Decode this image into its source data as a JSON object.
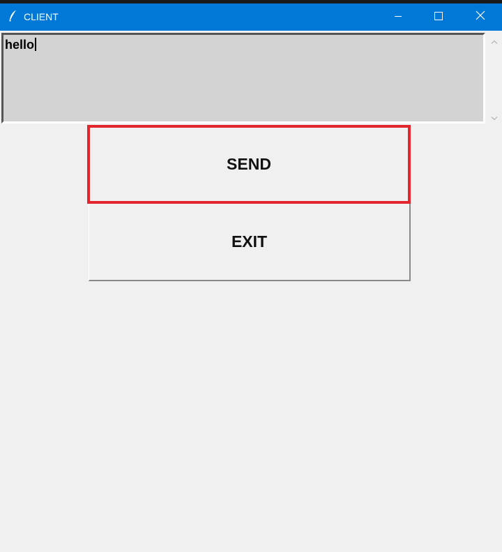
{
  "window": {
    "title": "CLIENT",
    "icon": "feather-icon",
    "controls": {
      "minimize_icon": "minimize-icon",
      "maximize_icon": "maximize-icon",
      "close_icon": "close-icon"
    },
    "titlebar_color": "#0078d7"
  },
  "message_box": {
    "value": "hello",
    "background_color": "#d3d3d3"
  },
  "scrollbar": {
    "up_icon": "chevron-up-icon",
    "down_icon": "chevron-down-icon"
  },
  "buttons": {
    "send_label": "SEND",
    "exit_label": "EXIT",
    "highlight_color": "#e3262e"
  }
}
